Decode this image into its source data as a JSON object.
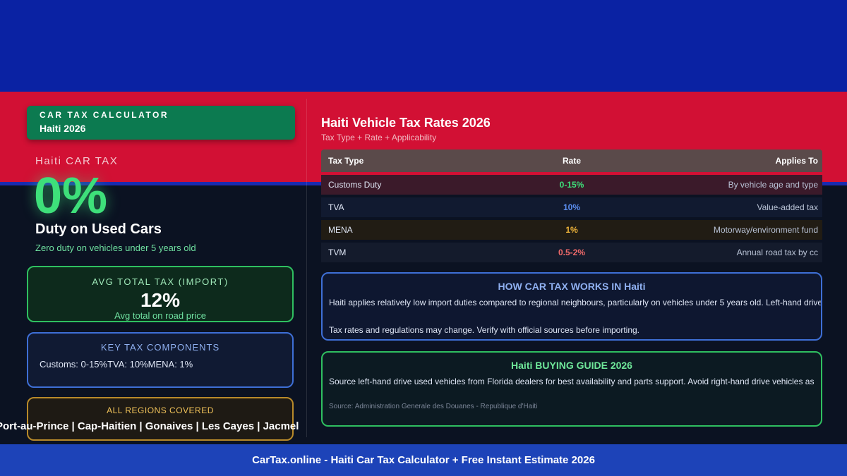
{
  "badge": {
    "label": "CAR TAX CALCULATOR",
    "sub": "Haiti 2026"
  },
  "hero": {
    "country_label": "Haiti CAR TAX",
    "big_value": "0%",
    "headline": "Duty on Used Cars",
    "subline": "Zero duty on vehicles under 5 years old"
  },
  "avg_card": {
    "title": "AVG TOTAL TAX (IMPORT)",
    "value": "12%",
    "note": "Avg total on road price"
  },
  "components_card": {
    "title": "KEY TAX COMPONENTS",
    "body": "Customs: 0-15%TVA: 10%MENA: 1%"
  },
  "regions_card": {
    "title": "ALL REGIONS COVERED",
    "cities": "Port-au-Prince | Cap-Haitien | Gonaives | Les Cayes | Jacmel"
  },
  "rates": {
    "title": "Haiti Vehicle Tax Rates 2026",
    "subtitle": "Tax Type + Rate + Applicability",
    "headers": [
      "Tax Type",
      "Rate",
      "Applies To"
    ],
    "rows": [
      {
        "type": "Customs Duty",
        "rate": "0-15%",
        "applies": "By vehicle age and type",
        "color": "#3ee07a"
      },
      {
        "type": "TVA",
        "rate": "10%",
        "applies": "Value-added tax",
        "color": "#5b8ef0"
      },
      {
        "type": "MENA",
        "rate": "1%",
        "applies": "Motorway/environment fund",
        "color": "#f1b53a"
      },
      {
        "type": "TVM",
        "rate": "0.5-2%",
        "applies": "Annual road tax by cc",
        "color": "#f06a6a"
      }
    ]
  },
  "how_it_works": {
    "title": "HOW CAR TAX WORKS IN Haiti",
    "text": "Haiti applies relatively low import duties compared to regional neighbours, particularly on vehicles under 5 years old. Left-hand drive",
    "text2": "Tax rates and regulations may change. Verify with official sources before importing."
  },
  "buying_guide": {
    "title": "Haiti BUYING GUIDE 2026",
    "text": "Source left-hand drive used vehicles from Florida dealers for best availability and parts support. Avoid right-hand drive vehicles as",
    "source": "Source: Administration Generale des Douanes - Republique d'Haiti"
  },
  "footer": {
    "text": "CarTax.online - Haiti Car Tax Calculator + Free Instant Estimate 2026"
  }
}
